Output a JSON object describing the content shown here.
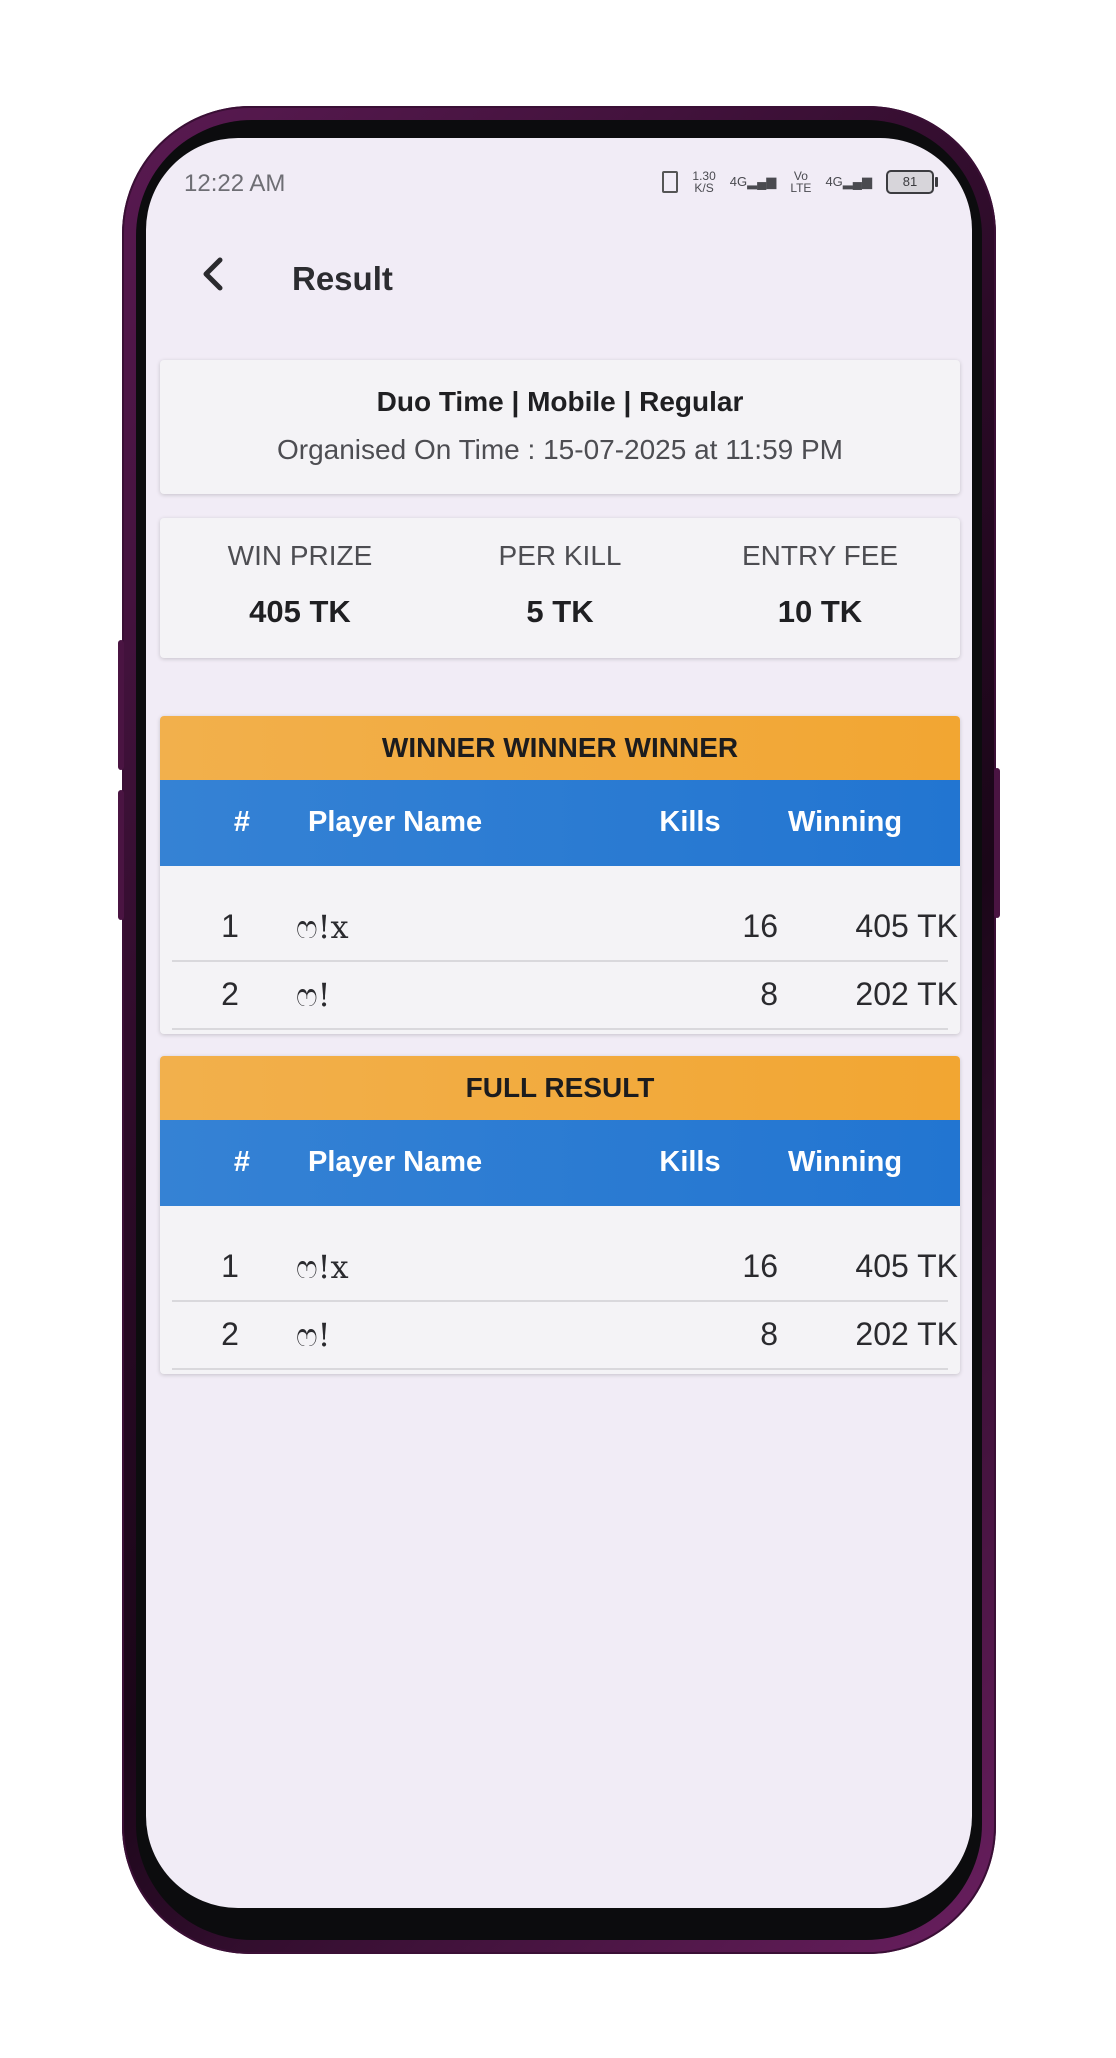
{
  "status_bar": {
    "time": "12:22 AM",
    "speed": "1.30",
    "speed_unit": "K/S",
    "net1": "4G",
    "volte": "Vo",
    "volte2": "LTE",
    "net2": "4G",
    "battery": "81"
  },
  "header": {
    "title": "Result"
  },
  "match": {
    "title": "Duo Time | Mobile | Regular",
    "organised": "Organised On Time :  15-07-2025 at  11:59 PM"
  },
  "stats": {
    "win_prize_label": "WIN PRIZE",
    "win_prize_value": "405 TK",
    "per_kill_label": "PER KILL",
    "per_kill_value": "5 TK",
    "entry_fee_label": "ENTRY FEE",
    "entry_fee_value": "10 TK"
  },
  "columns": {
    "rank": "#",
    "name": "Player Name",
    "kills": "Kills",
    "winning": "Winning"
  },
  "winner_section": {
    "title": "WINNER WINNER WINNER",
    "rows": [
      {
        "rank": "1",
        "name": "ෆ!x",
        "kills": "16",
        "winning": "405 TK"
      },
      {
        "rank": "2",
        "name": "ෆ!",
        "kills": "8",
        "winning": "202 TK"
      }
    ]
  },
  "full_section": {
    "title": "FULL RESULT",
    "rows": [
      {
        "rank": "1",
        "name": "ෆ!x",
        "kills": "16",
        "winning": "405 TK"
      },
      {
        "rank": "2",
        "name": "ෆ!",
        "kills": "8",
        "winning": "202 TK"
      }
    ]
  },
  "colors": {
    "banner": "#f2a632",
    "table_header": "#2275d1",
    "background": "#f1ecf6"
  }
}
